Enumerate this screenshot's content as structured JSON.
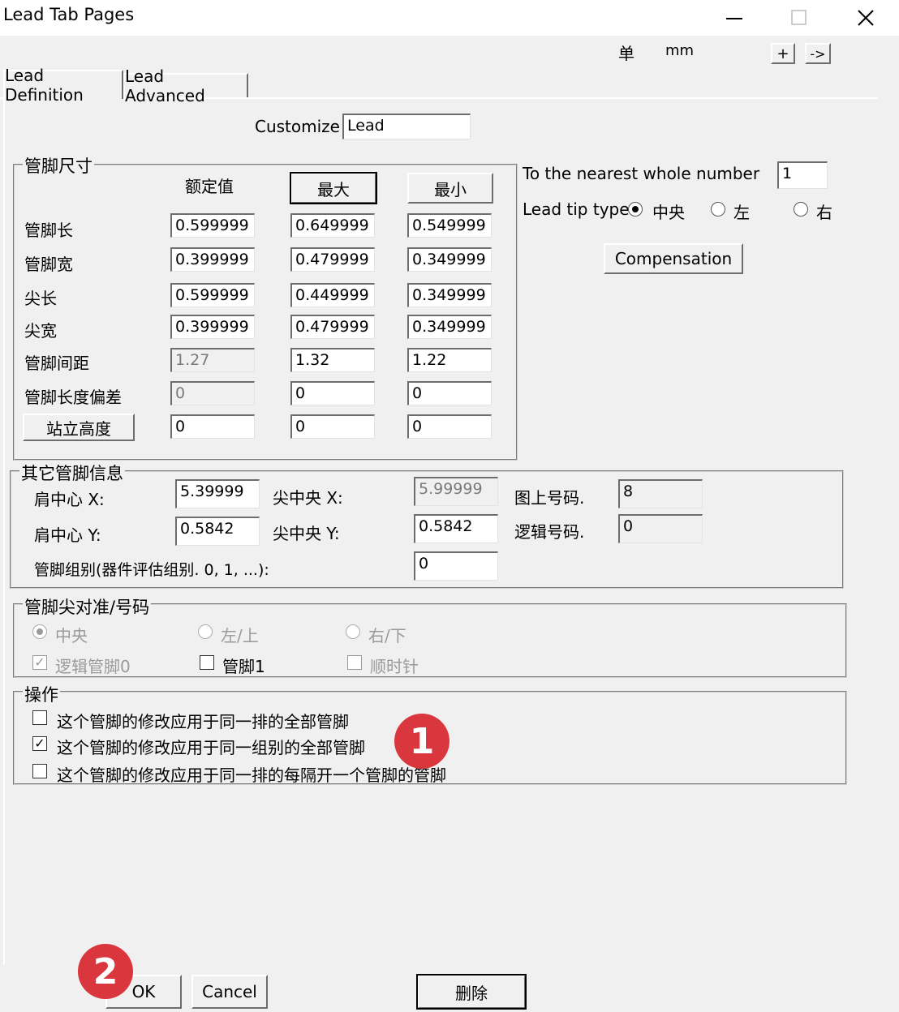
{
  "window": {
    "title": "Lead Tab Pages"
  },
  "units": {
    "label": "单",
    "value": "mm",
    "plus": "+",
    "arrow": "->"
  },
  "tabs": [
    {
      "label": "Lead Definition"
    },
    {
      "label": "Lead Advanced"
    }
  ],
  "customize": {
    "label": "Customize",
    "value": "Lead"
  },
  "dims": {
    "title": "管脚尺寸",
    "col_nominal": "额定值",
    "col_max": "最大",
    "col_min": "最小",
    "rows": [
      {
        "label": "管脚长",
        "nominal": "0.599999",
        "max": "0.649999",
        "min": "0.549999"
      },
      {
        "label": "管脚宽",
        "nominal": "0.399999",
        "max": "0.479999",
        "min": "0.349999"
      },
      {
        "label": "尖长",
        "nominal": "0.599999",
        "max": "0.449999",
        "min": "0.349999"
      },
      {
        "label": "尖宽",
        "nominal": "0.399999",
        "max": "0.479999",
        "min": "0.349999"
      },
      {
        "label": "管脚间距",
        "nominal": "1.27",
        "max": "1.32",
        "min": "1.22"
      },
      {
        "label": "管脚长度偏差",
        "nominal": "0",
        "max": "0",
        "min": "0"
      },
      {
        "label": "站立高度",
        "nominal": "0",
        "max": "0",
        "min": "0"
      }
    ]
  },
  "rounding": {
    "label": "To the nearest whole number",
    "value": "1"
  },
  "tip_type": {
    "label": "Lead tip type",
    "options": [
      "中央",
      "左",
      "右"
    ],
    "selected": "中央"
  },
  "compensation": {
    "label": "Compensation"
  },
  "other": {
    "title": "其它管脚信息",
    "shoulder_x_label": "肩中心 X:",
    "shoulder_x": "5.39999",
    "shoulder_y_label": "肩中心 Y:",
    "shoulder_y": "0.5842",
    "tip_x_label": "尖中央 X:",
    "tip_x": "5.99999",
    "tip_y_label": "尖中央 Y:",
    "tip_y": "0.5842",
    "drawing_no_label": "图上号码.",
    "drawing_no": "8",
    "logic_no_label": "逻辑号码.",
    "logic_no": "0",
    "group_label": "管脚组别(器件评估组别. 0, 1, ...):",
    "group": "0"
  },
  "align": {
    "title": "管脚尖对准/号码",
    "radios": [
      "中央",
      "左/上",
      "右/下"
    ],
    "checks": [
      {
        "label": "逻辑管脚0",
        "checked": true
      },
      {
        "label": "管脚1",
        "checked": false
      },
      {
        "label": "顺时针",
        "checked": false
      }
    ]
  },
  "ops": {
    "title": "操作",
    "items": [
      {
        "label": "这个管脚的修改应用于同一排的全部管脚",
        "checked": false
      },
      {
        "label": "这个管脚的修改应用于同一组别的全部管脚",
        "checked": true
      },
      {
        "label": "这个管脚的修改应用于同一排的每隔开一个管脚的管脚",
        "checked": false
      }
    ]
  },
  "buttons": {
    "ok": "OK",
    "cancel": "Cancel",
    "delete": "删除"
  },
  "badges": {
    "one": "1",
    "two": "2",
    "color": "#d9363e"
  }
}
